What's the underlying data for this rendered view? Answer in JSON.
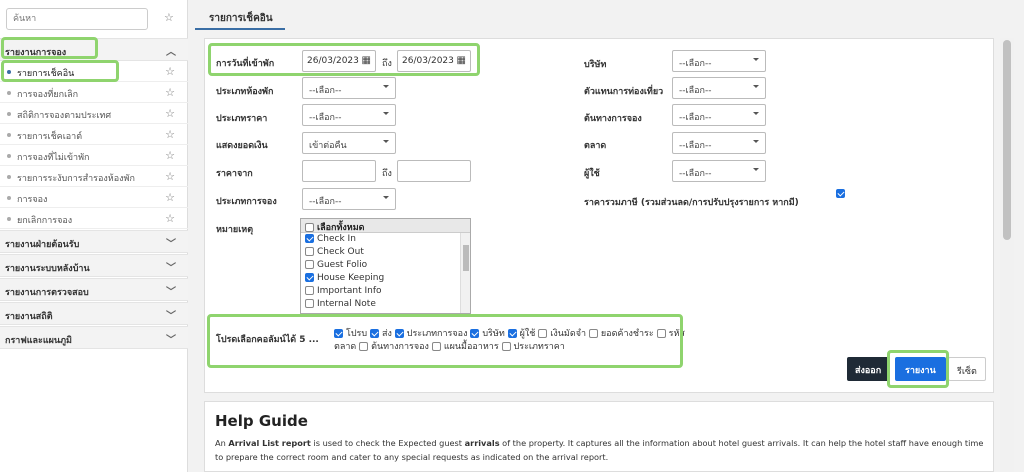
{
  "sidebar": {
    "search_placeholder": "ค้นหา",
    "sections": [
      {
        "label": "รายงานการจอง"
      },
      {
        "label": "รายงานฝ่ายต้อนรับ"
      },
      {
        "label": "รายงานระบบหลังบ้าน"
      },
      {
        "label": "รายงานการตรวจสอบ"
      },
      {
        "label": "รายงานสถิติ"
      },
      {
        "label": "กราฟและแผนภูมิ"
      }
    ],
    "items": [
      {
        "label": "รายการเช็คอิน"
      },
      {
        "label": "การจองที่ยกเลิก"
      },
      {
        "label": "สถิติการจองตามประเทศ"
      },
      {
        "label": "รายการเช็คเอาต์"
      },
      {
        "label": "การจองที่ไม่เข้าพัก"
      },
      {
        "label": "รายการระงับการสำรองห้องพัก"
      },
      {
        "label": "การจอง"
      },
      {
        "label": "ยกเลิกการจอง"
      }
    ]
  },
  "tab": {
    "label": "รายการเช็คอิน"
  },
  "form": {
    "arrival_label": "การวันที่เข้าพัก",
    "date_from": "26/03/2023",
    "to_label": "ถึง",
    "date_to": "26/03/2023",
    "room_type_label": "ประเภทห้องพัก",
    "rate_type_label": "ประเภทราคา",
    "amount_label": "แสดงยอดเงิน",
    "price_from_label": "ราคาจาก",
    "price_to_label": "ถึง",
    "booking_type_label": "ประเภทการจอง",
    "remark_label": "หมายเหตุ",
    "company_label": "บริษัท",
    "agent_label": "ตัวแทนการท่องเที่ยว",
    "source_label": "ต้นทางการจอง",
    "market_label": "ตลาด",
    "user_label": "ผู้ใช้",
    "tax_label": "ราคารวมภาษี (รวมส่วนลด/การปรับปรุงรายการ หากมี)",
    "select_default": "--เลือก--",
    "amount_value": "เข้าต่อคืน",
    "remarks": {
      "select_all": "เลือกทั้งหมด",
      "options": [
        {
          "label": "Check In",
          "checked": true
        },
        {
          "label": "Check Out",
          "checked": false
        },
        {
          "label": "Guest Folio",
          "checked": false
        },
        {
          "label": "House Keeping",
          "checked": true
        },
        {
          "label": "Important Info",
          "checked": false
        },
        {
          "label": "Internal Note",
          "checked": false
        }
      ]
    },
    "columns_label": "โปรดเลือกคอลัมน์ได้ 5 ...",
    "columns": [
      {
        "label": "โปรบ",
        "checked": true
      },
      {
        "label": "ส่ง",
        "checked": true
      },
      {
        "label": "ประเภทการจอง",
        "checked": true
      },
      {
        "label": "บริษัท",
        "checked": true
      },
      {
        "label": "ผู้ใช้",
        "checked": true
      },
      {
        "label": "เงินมัดจำ",
        "checked": false
      },
      {
        "label": "ยอดค้างชำระ",
        "checked": false
      },
      {
        "label": "รหัสตลาด",
        "checked": false
      },
      {
        "label": "ต้นทางการจอง",
        "checked": false
      },
      {
        "label": "แผนมื้ออาหาร",
        "checked": false
      },
      {
        "label": "ประเภทราคา",
        "checked": false
      }
    ]
  },
  "buttons": {
    "export": "ส่งออก",
    "report": "รายงาน",
    "reset": "รีเซ็ต"
  },
  "help": {
    "title": "Help Guide",
    "p1": "An ",
    "p1b": "Arrival List report",
    "p1c": " is used to check the Expected guest ",
    "p1d": "arrivals",
    "p1e": " of the property. It captures all the information about hotel guest arrivals. It can help the hotel staff have enough time to prepare the correct room and cater to any special requests as indicated on the arrival report."
  },
  "colors": {
    "accent": "#1a6fe0",
    "highlight": "#8fd46e",
    "dark_button": "#1f2a36"
  }
}
